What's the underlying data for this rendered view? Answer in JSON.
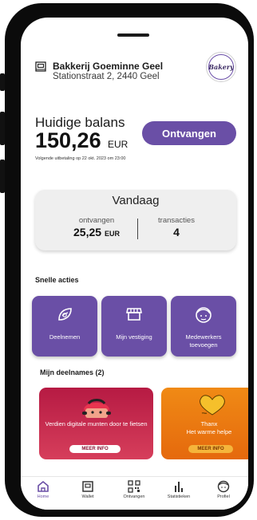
{
  "store": {
    "name": "Bakkerij Goeminne Geel",
    "address": "Stationstraat 2, 2440 Geel",
    "logo_text": "Bakery"
  },
  "balance": {
    "title": "Huidige balans",
    "amount": "150,26",
    "currency": "EUR",
    "next_payout": "Volgende uitbetaling op 22 okt. 2023 om 23:00"
  },
  "receive_button": "Ontvangen",
  "today": {
    "title": "Vandaag",
    "received_label": "ontvangen",
    "received_value": "25,25",
    "received_currency": "EUR",
    "transactions_label": "transacties",
    "transactions_value": "4"
  },
  "quick_actions": {
    "heading": "Snelle acties",
    "items": [
      {
        "label": "Deelnemen",
        "icon": "leaf-icon"
      },
      {
        "label": "Mijn vestiging",
        "icon": "shop-icon"
      },
      {
        "label": "Medewerkers toevoegen",
        "icon": "face-icon"
      }
    ]
  },
  "participations": {
    "heading": "Mijn deelnames (2)",
    "cards": [
      {
        "text": "Verdien digitale munten door te fietsen",
        "button": "MEER INFO",
        "color": "#c52a4e"
      },
      {
        "title": "Thanx",
        "text": "Het warme helpe",
        "button": "MEER INFO",
        "color": "#ef7f12"
      }
    ]
  },
  "nav": {
    "items": [
      {
        "label": "Home",
        "icon": "home-icon",
        "active": true
      },
      {
        "label": "Wallet",
        "icon": "wallet-icon",
        "active": false
      },
      {
        "label": "Ontvangen",
        "icon": "qr-code-icon",
        "active": false
      },
      {
        "label": "Statistieken",
        "icon": "bar-chart-icon",
        "active": false
      },
      {
        "label": "Profiel",
        "icon": "profile-icon",
        "active": false
      }
    ]
  },
  "colors": {
    "accent": "#6a4fa6",
    "card_bg": "#efefef"
  }
}
